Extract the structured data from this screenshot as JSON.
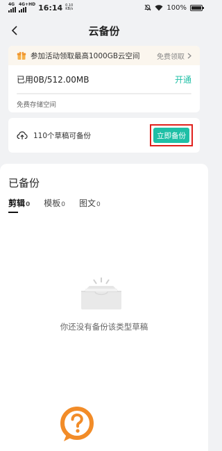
{
  "status_bar": {
    "network_1": "4G",
    "network_2": "4G+HD",
    "time": "16:14",
    "speed": "0.10\nKB/s",
    "battery": "100%",
    "battery_level": 1.0
  },
  "header": {
    "title": "云备份"
  },
  "promo": {
    "text": "参加活动领取最高1000GB云空间",
    "link": "免费领取"
  },
  "storage": {
    "usage": "已用0B/512.00MB",
    "action": "开通",
    "used_fraction": 0,
    "plan_label": "免费存储空间"
  },
  "backup": {
    "drafts_text": "110个草稿可备份",
    "button": "立即备份"
  },
  "backed_up": {
    "title": "已备份",
    "tabs": [
      {
        "label": "剪辑",
        "count": "0"
      },
      {
        "label": "模板",
        "count": "0"
      },
      {
        "label": "图文",
        "count": "0"
      }
    ],
    "empty_text": "你还没有备份该类型草稿"
  },
  "colors": {
    "accent": "#1fbfa6",
    "highlight_frame": "#e0201c",
    "help_orange": "#f28c28"
  }
}
